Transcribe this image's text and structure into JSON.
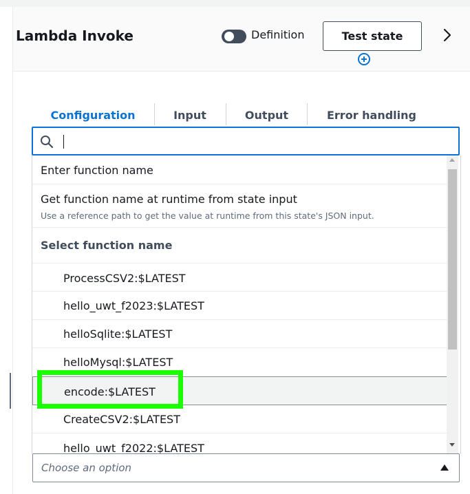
{
  "header": {
    "title": "Lambda Invoke",
    "definition_label": "Definition",
    "definition_toggle_on": false,
    "test_state_label": "Test state"
  },
  "tabs": [
    {
      "label": "Configuration",
      "active": true
    },
    {
      "label": "Input",
      "active": false
    },
    {
      "label": "Output",
      "active": false
    },
    {
      "label": "Error handling",
      "active": false
    }
  ],
  "search": {
    "value": "",
    "placeholder": ""
  },
  "options": {
    "enter_name": "Enter function name",
    "runtime_title": "Get function name at runtime from state input",
    "runtime_desc": "Use a reference path to get the value at runtime from this state's JSON input.",
    "group_label": "Select function name",
    "functions": [
      "ProcessCSV2:$LATEST",
      "hello_uwt_f2023:$LATEST",
      "helloSqlite:$LATEST",
      "helloMysql:$LATEST",
      "encode:$LATEST",
      "CreateCSV2:$LATEST",
      "hello_uwt_f2022:$LATEST"
    ],
    "highlighted_function": "encode:$LATEST"
  },
  "select": {
    "placeholder": "Choose an option"
  },
  "icons": {
    "search": "search-icon",
    "add": "plus-circle-icon",
    "chevron": "chevron-right-icon",
    "caret": "caret-up-icon"
  },
  "colors": {
    "accent": "#0972d3",
    "highlight": "#1cff00"
  }
}
